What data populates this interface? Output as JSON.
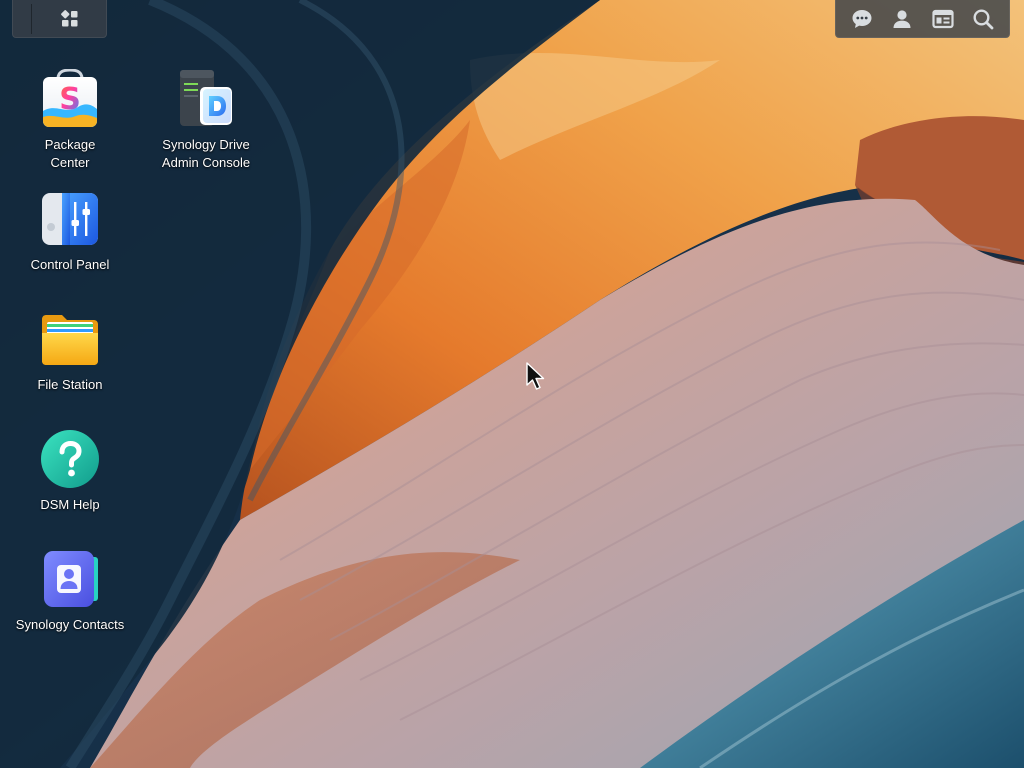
{
  "taskbar": {
    "main_menu_icon": "grid-icon"
  },
  "tray": {
    "items": [
      {
        "icon": "chat-icon"
      },
      {
        "icon": "user-icon"
      },
      {
        "icon": "widgets-icon"
      },
      {
        "icon": "search-icon"
      }
    ]
  },
  "desktop": {
    "icons": [
      {
        "label_line1": "Package",
        "label_line2": "Center",
        "icon": "package-center-icon"
      },
      {
        "label_line1": "Synology Drive",
        "label_line2": "Admin Console",
        "icon": "synology-drive-icon"
      },
      {
        "label_line1": "Control Panel",
        "label_line2": "",
        "icon": "control-panel-icon"
      },
      {
        "label_line1": "File Station",
        "label_line2": "",
        "icon": "file-station-icon"
      },
      {
        "label_line1": "DSM Help",
        "label_line2": "",
        "icon": "help-icon"
      },
      {
        "label_line1": "Synology Contacts",
        "label_line2": "",
        "icon": "contacts-icon"
      }
    ]
  },
  "colors": {
    "tray_bg": "#384048",
    "icon_glyph": "#d9dde0",
    "label_text": "#ffffff"
  }
}
